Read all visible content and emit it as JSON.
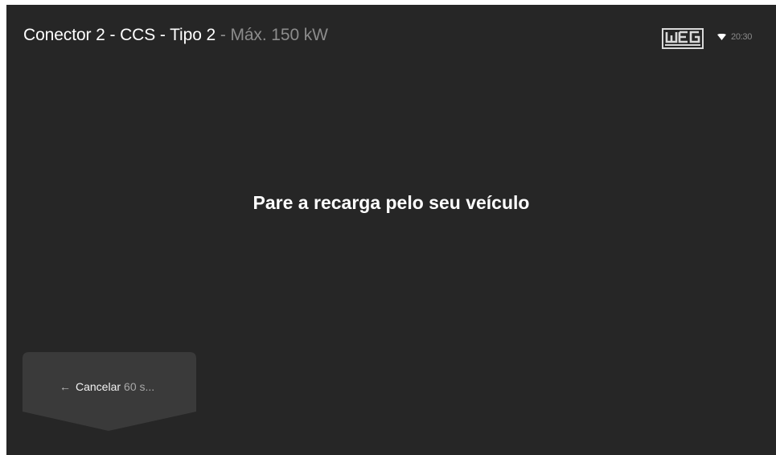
{
  "header": {
    "title": "Conector 2 - CCS - Tipo 2",
    "subtitle": " - Máx. 150 kW"
  },
  "status_bar": {
    "brand_logo": "weg-logo",
    "wifi_icon": "wifi-icon",
    "time": "20:30"
  },
  "main": {
    "message": "Pare a recarga pelo seu veículo"
  },
  "cancel_button": {
    "icon": "arrow-left-icon",
    "label": "Cancelar",
    "countdown": "60 s..."
  },
  "colors": {
    "background": "#262626",
    "button": "#3a3a3a",
    "text": "#ffffff",
    "muted_text": "#8c8c8c"
  }
}
